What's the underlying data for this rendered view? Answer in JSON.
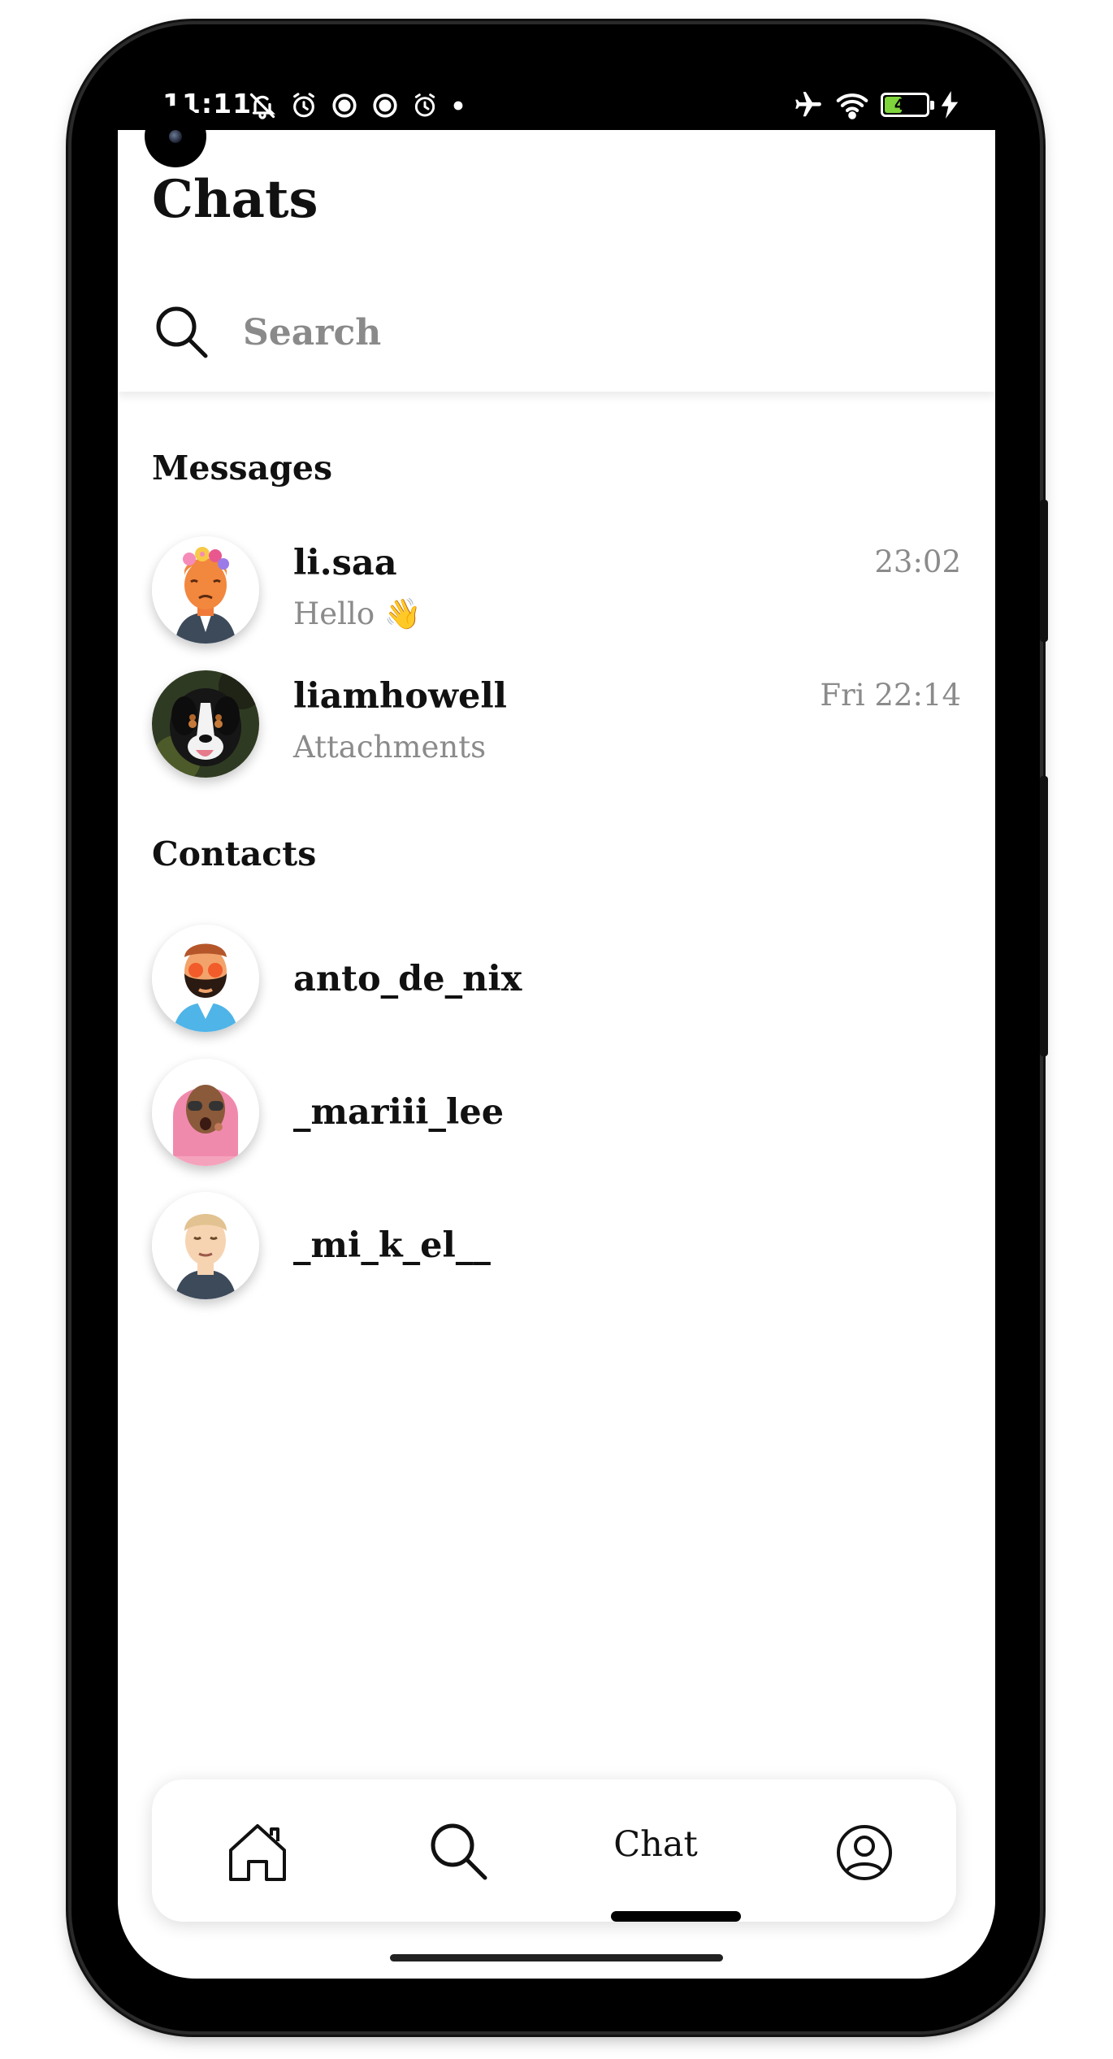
{
  "status_bar": {
    "time": "11:11",
    "left_icons": [
      "mute-icon",
      "alarm-icon",
      "sync-icon",
      "sync-icon",
      "alarm-icon",
      "dot-icon"
    ],
    "right_icons": [
      "airplane-icon",
      "wifi-icon",
      "battery-icon",
      "charging-icon"
    ],
    "battery": "46",
    "battery_color": "#7fd33b"
  },
  "header": {
    "title": "Chats",
    "search_placeholder": "Search"
  },
  "messages": {
    "section_title": "Messages",
    "items": [
      {
        "name": "li.saa",
        "preview": "Hello 👋",
        "time": "23:02",
        "avatar": "girl-flower-crown-avatar"
      },
      {
        "name": "liamhowell",
        "preview": "Attachments",
        "time": "Fri 22:14",
        "avatar": "dog-photo-avatar"
      }
    ]
  },
  "contacts": {
    "section_title": "Contacts",
    "items": [
      {
        "name": "anto_de_nix",
        "avatar": "bearded-man-avatar"
      },
      {
        "name": "_mariii_lee",
        "avatar": "pink-hair-woman-avatar"
      },
      {
        "name": "_mi_k_el__",
        "avatar": "blond-man-avatar"
      }
    ]
  },
  "bottom_nav": {
    "items": [
      "home-icon",
      "search-icon",
      "Chat",
      "profile-icon"
    ],
    "active": "Chat",
    "chat_label": "Chat"
  }
}
